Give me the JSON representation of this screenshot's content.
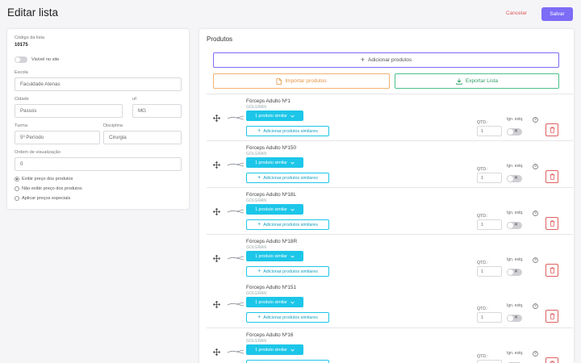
{
  "header": {
    "title": "Editar lista",
    "cancel_label": "Cancelar",
    "save_label": "Salvar"
  },
  "form": {
    "code_label": "Código da lista",
    "code_value": "10175",
    "visible_label": "Visível no site",
    "school_label": "Escola",
    "school_value": "Faculdade Atenas",
    "city_label": "Cidade",
    "city_value": "Passos",
    "uf_label": "uf:",
    "uf_value": "MG",
    "class_label": "Turma",
    "class_value": "5º Período",
    "discipline_label": "Disciplina",
    "discipline_value": "Cirurgia",
    "order_label": "Ordem de visualização",
    "order_value": "0",
    "price_options": [
      {
        "label": "Exibir preço dos produtos",
        "selected": true
      },
      {
        "label": "Não exibir preço dos produtos",
        "selected": false
      },
      {
        "label": "Aplicar preços especiais",
        "selected": false
      }
    ]
  },
  "products_section": {
    "title": "Produtos",
    "add_label": "Adicionar produtos",
    "import_label": "Importar produtos",
    "export_label": "Exportar Lista"
  },
  "product_common": {
    "similar_label": "1 produto similar",
    "add_similar_label": "Adicionar produtos similares",
    "qtd_label": "QTD.:",
    "ign_label": "Ign. estq.",
    "x_mark": "✕"
  },
  "products": [
    {
      "name": "Fórceps Adulto Nº1",
      "brand": "GOLGRAN",
      "qty": "1"
    },
    {
      "name": "Fórceps Adulto Nº150",
      "brand": "GOLGRAN",
      "qty": "1"
    },
    {
      "name": "Fórceps Adulto Nº18L",
      "brand": "GOLGRAN",
      "qty": "1"
    },
    {
      "name": "Fórceps Adulto Nº18R",
      "brand": "GOLGRAN",
      "qty": "1"
    },
    {
      "name": "Fórceps Adulto Nº151",
      "brand": "GOLGRAN",
      "qty": "1"
    },
    {
      "name": "Fórceps Adulto Nº16",
      "brand": "GOLGRAN",
      "qty": "1"
    }
  ],
  "colors": {
    "accent": "#7c6cf6",
    "cyan": "#1cc6e8",
    "danger": "#e05a5a",
    "orange": "#e89440",
    "green": "#2f9e64"
  }
}
